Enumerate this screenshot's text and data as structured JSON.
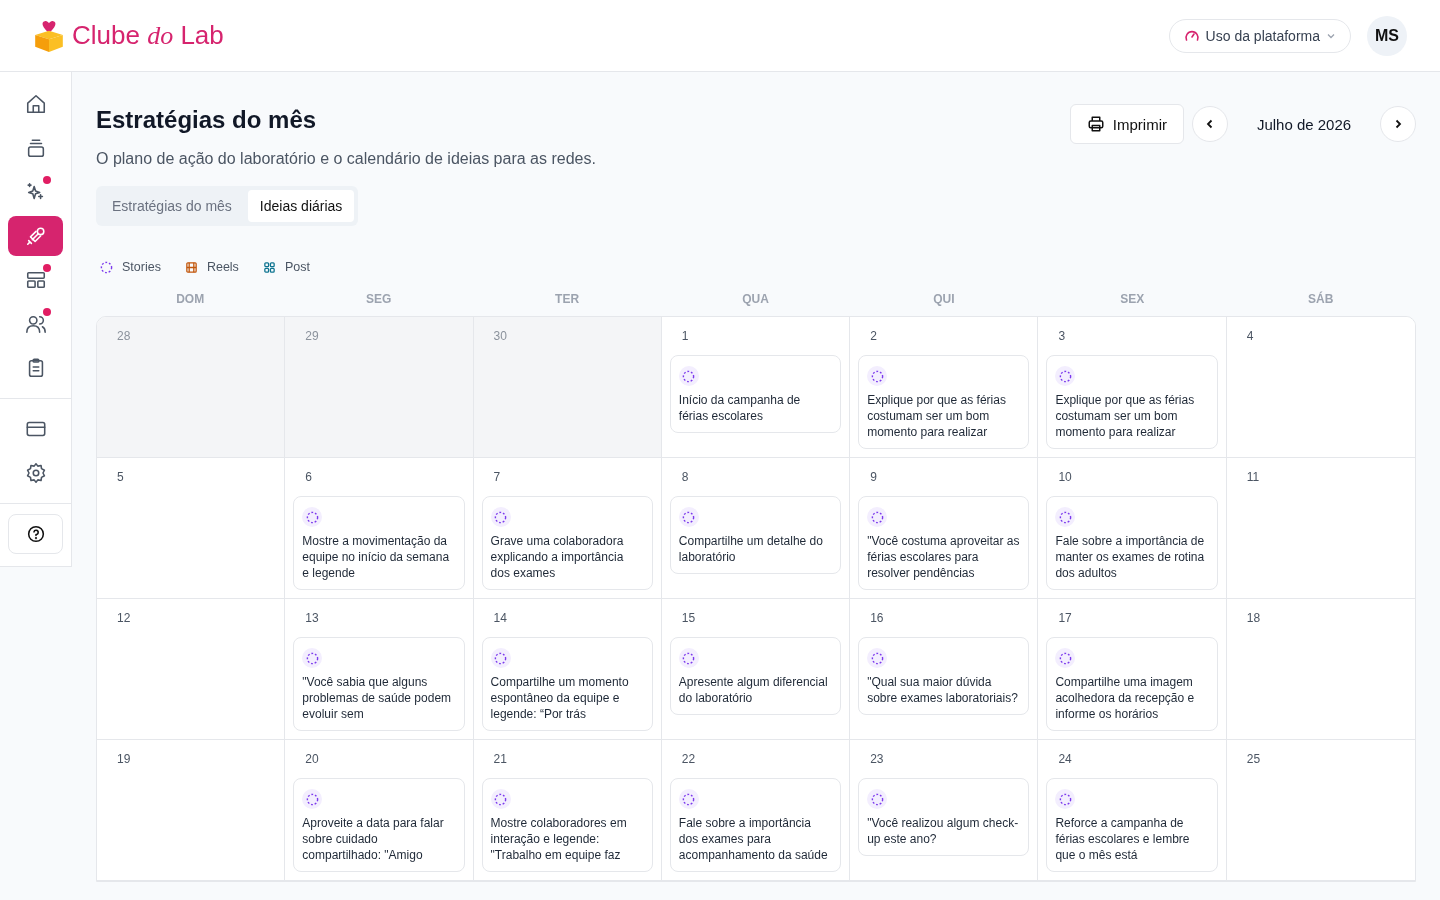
{
  "brand": {
    "name_start": "Clube",
    "name_middle": "do",
    "name_end": "Lab"
  },
  "header": {
    "usage_button": "Uso da plataforma",
    "avatar": "MS"
  },
  "sidebar": {
    "items": [
      {
        "selected": false,
        "badge": false
      },
      {
        "selected": false,
        "badge": false
      },
      {
        "selected": false,
        "badge": true
      },
      {
        "selected": true,
        "badge": false
      },
      {
        "selected": false,
        "badge": true
      },
      {
        "selected": false,
        "badge": true
      },
      {
        "selected": false,
        "badge": false
      },
      {
        "selected": false,
        "badge": false
      },
      {
        "selected": false,
        "badge": false
      },
      {
        "selected": false,
        "badge": false
      }
    ]
  },
  "page": {
    "title": "Estratégias do mês",
    "subtitle": "O plano de ação do laboratório e o calendário de ideias para as redes.",
    "print_button": "Imprimir",
    "month": "Julho de 2026"
  },
  "tabs": [
    {
      "label": "Estratégias do mês",
      "selected": false
    },
    {
      "label": "Ideias diárias",
      "selected": true
    }
  ],
  "legend": [
    {
      "kind": "stories",
      "label": "Stories"
    },
    {
      "kind": "reels",
      "label": "Reels"
    },
    {
      "kind": "post",
      "label": "Post"
    }
  ],
  "weekdays": [
    "DOM",
    "SEG",
    "TER",
    "QUA",
    "QUI",
    "SEX",
    "SÁB"
  ],
  "weeks": [
    [
      {
        "day": "28",
        "outside": true
      },
      {
        "day": "29",
        "outside": true
      },
      {
        "day": "30",
        "outside": true
      },
      {
        "day": "1",
        "outside": false,
        "ideas": [
          {
            "kind": "stories",
            "text": "Início da campanha de férias escolares"
          }
        ]
      },
      {
        "day": "2",
        "outside": false,
        "ideas": [
          {
            "kind": "stories",
            "text": "Explique por que as férias costumam ser um bom momento para realizar"
          }
        ]
      },
      {
        "day": "3",
        "outside": false,
        "ideas": [
          {
            "kind": "stories",
            "text": "Explique por que as férias costumam ser um bom momento para realizar"
          }
        ]
      },
      {
        "day": "4",
        "outside": false
      }
    ],
    [
      {
        "day": "5",
        "outside": false
      },
      {
        "day": "6",
        "outside": false,
        "ideas": [
          {
            "kind": "stories",
            "text": "Mostre a movimentação da equipe no início da semana e legende"
          }
        ]
      },
      {
        "day": "7",
        "outside": false,
        "ideas": [
          {
            "kind": "stories",
            "text": "Grave uma colaboradora explicando a importância dos exames"
          }
        ]
      },
      {
        "day": "8",
        "outside": false,
        "ideas": [
          {
            "kind": "stories",
            "text": "Compartilhe um detalhe do laboratório"
          }
        ]
      },
      {
        "day": "9",
        "outside": false,
        "ideas": [
          {
            "kind": "stories",
            "text": "\"Você costuma aproveitar as férias escolares para resolver pendências"
          }
        ]
      },
      {
        "day": "10",
        "outside": false,
        "ideas": [
          {
            "kind": "stories",
            "text": "Fale sobre a importância de manter os exames de rotina dos adultos"
          }
        ]
      },
      {
        "day": "11",
        "outside": false
      }
    ],
    [
      {
        "day": "12",
        "outside": false
      },
      {
        "day": "13",
        "outside": false,
        "ideas": [
          {
            "kind": "stories",
            "text": "\"Você sabia que alguns problemas de saúde podem evoluir sem"
          }
        ]
      },
      {
        "day": "14",
        "outside": false,
        "ideas": [
          {
            "kind": "stories",
            "text": "Compartilhe um momento espontâneo da equipe e legende: “Por trás"
          }
        ]
      },
      {
        "day": "15",
        "outside": false,
        "ideas": [
          {
            "kind": "stories",
            "text": "Apresente algum diferencial do laboratório"
          }
        ]
      },
      {
        "day": "16",
        "outside": false,
        "ideas": [
          {
            "kind": "stories",
            "text": "\"Qual sua maior dúvida sobre exames laboratoriais?"
          }
        ]
      },
      {
        "day": "17",
        "outside": false,
        "ideas": [
          {
            "kind": "stories",
            "text": "Compartilhe uma imagem acolhedora da recepção e informe os horários"
          }
        ]
      },
      {
        "day": "18",
        "outside": false
      }
    ],
    [
      {
        "day": "19",
        "outside": false
      },
      {
        "day": "20",
        "outside": false,
        "ideas": [
          {
            "kind": "stories",
            "text": "Aproveite a data para falar sobre cuidado compartilhado: \"Amigo"
          }
        ]
      },
      {
        "day": "21",
        "outside": false,
        "ideas": [
          {
            "kind": "stories",
            "text": "Mostre colaboradores em interação e legende: \"Trabalho em equipe faz"
          }
        ]
      },
      {
        "day": "22",
        "outside": false,
        "ideas": [
          {
            "kind": "stories",
            "text": "Fale sobre a importância dos exames para acompanhamento da saúde"
          }
        ]
      },
      {
        "day": "23",
        "outside": false,
        "ideas": [
          {
            "kind": "stories",
            "text": "\"Você realizou algum check-up este ano?"
          }
        ]
      },
      {
        "day": "24",
        "outside": false,
        "ideas": [
          {
            "kind": "stories",
            "text": "Reforce a campanha de férias escolares e lembre que o mês está"
          }
        ]
      },
      {
        "day": "25",
        "outside": false
      }
    ]
  ]
}
